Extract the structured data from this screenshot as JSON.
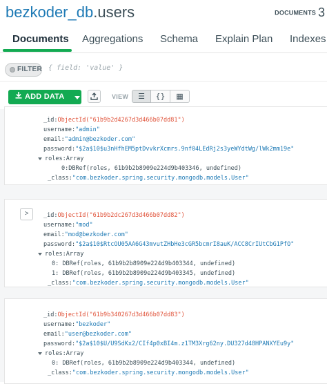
{
  "header": {
    "db_name": "bezkoder_db",
    "collection_name": ".users",
    "documents_label": "DOCUMENTS",
    "documents_count": "3"
  },
  "tabs": [
    {
      "label": "Documents",
      "active": true
    },
    {
      "label": "Aggregations",
      "active": false
    },
    {
      "label": "Schema",
      "active": false
    },
    {
      "label": "Explain Plan",
      "active": false
    },
    {
      "label": "Indexes",
      "active": false
    }
  ],
  "filter": {
    "label": "FILTER",
    "placeholder": "{ field: 'value' }"
  },
  "toolbar": {
    "add_data_label": "ADD DATA",
    "view_label": "VIEW",
    "list_view_icon": "☰",
    "json_view_icon": "{}",
    "table_view_icon": "▦",
    "expand_icon": ">"
  },
  "documents": [
    {
      "id_key": "_id:",
      "id_value": "ObjectId(\"61b9b2d4267d3d466b07dd81\")",
      "username_key": "username:",
      "username_value": "\"admin\"",
      "email_key": "email:",
      "email_value": "\"admin@bezkoder.com\"",
      "password_key": "password:",
      "password_value": "\"$2a$10$u3nHfhEM5ptDvvkrXcmrs.9nf04LEdRj2s3yeWYdtWg/lWk2mm19e\"",
      "roles_key": "roles:",
      "roles_type": "Array",
      "roles": [
        {
          "index": "0:",
          "value": "DBRef(roles, 61b9b2b8909e224d9b403346, undefined)"
        }
      ],
      "class_key": "_class:",
      "class_value": "\"com.bezkoder.spring.security.mongodb.models.User\""
    },
    {
      "id_key": "_id:",
      "id_value": "ObjectId(\"61b9b2dc267d3d466b07dd82\")",
      "username_key": "username:",
      "username_value": "\"mod\"",
      "email_key": "email:",
      "email_value": "\"mod@bezkoder.com\"",
      "password_key": "password:",
      "password_value": "\"$2a$10$RtcOU05AA6G43mvutZHbHe3cGR5bcmrI8auK/ACC8CrIUtCbG1PfO\"",
      "roles_key": "roles:",
      "roles_type": "Array",
      "roles": [
        {
          "index": "0:",
          "value": "DBRef(roles, 61b9b2b8909e224d9b403344, undefined)"
        },
        {
          "index": "1:",
          "value": "DBRef(roles, 61b9b2b8909e224d9b403345, undefined)"
        }
      ],
      "class_key": "_class:",
      "class_value": "\"com.bezkoder.spring.security.mongodb.models.User\""
    },
    {
      "id_key": "_id:",
      "id_value": "ObjectId(\"61b9b340267d3d466b07dd83\")",
      "username_key": "username:",
      "username_value": "\"bezkoder\"",
      "email_key": "email:",
      "email_value": "\"user@bezkoder.com\"",
      "password_key": "password:",
      "password_value": "\"$2a$10$U/U9SdKx2/CIf4p0xBI4m.z1TM3Xrg62ny.DU327d48HPANXYEu9y\"",
      "roles_key": "roles:",
      "roles_type": "Array",
      "roles": [
        {
          "index": "0:",
          "value": "DBRef(roles, 61b9b2b8909e224d9b403344, undefined)"
        }
      ],
      "class_key": "_class:",
      "class_value": "\"com.bezkoder.spring.security.mongodb.models.User\""
    }
  ]
}
